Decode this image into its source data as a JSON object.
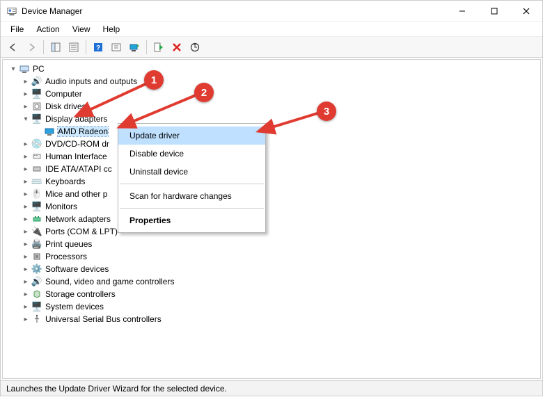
{
  "window": {
    "title": "Device Manager"
  },
  "menu": {
    "file": "File",
    "action": "Action",
    "view": "View",
    "help": "Help"
  },
  "tree": {
    "root": "PC",
    "nodes": {
      "audio": "Audio inputs and outputs",
      "computer": "Computer",
      "disk": "Disk drives",
      "display": "Display adapters",
      "display_child": "AMD Radeon",
      "dvd": "DVD/CD-ROM dr",
      "hid": "Human Interface",
      "ide": "IDE ATA/ATAPI cc",
      "keyboards": "Keyboards",
      "mice": "Mice and other p",
      "monitors": "Monitors",
      "network": "Network adapters",
      "ports": "Ports (COM & LPT)",
      "printq": "Print queues",
      "processors": "Processors",
      "software": "Software devices",
      "sound": "Sound, video and game controllers",
      "storage": "Storage controllers",
      "system": "System devices",
      "usb": "Universal Serial Bus controllers"
    }
  },
  "context_menu": {
    "update": "Update driver",
    "disable": "Disable device",
    "uninstall": "Uninstall device",
    "scan": "Scan for hardware changes",
    "properties": "Properties"
  },
  "status": {
    "text": "Launches the Update Driver Wizard for the selected device."
  },
  "annotations": {
    "b1": "1",
    "b2": "2",
    "b3": "3"
  },
  "colors": {
    "highlight": "#bfe0ff",
    "selection": "#cce8ff",
    "badge": "#e03b30"
  }
}
